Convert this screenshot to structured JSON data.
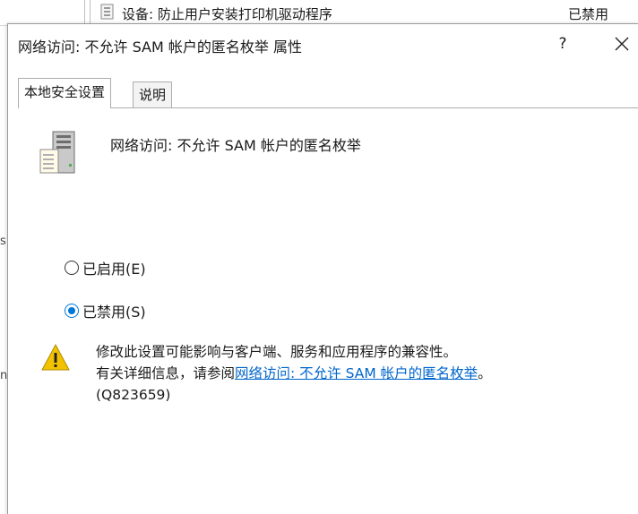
{
  "background_list": {
    "row_text": "设备: 防止用户安装打印机驱动程序",
    "row_status": "已禁用",
    "left_fragments": [
      "s",
      "n"
    ]
  },
  "dialog": {
    "title": "网络访问: 不允许 SAM 帐户的匿名枚举 属性",
    "help_label": "?",
    "tabs": [
      {
        "label": "本地安全设置",
        "active": true
      },
      {
        "label": "说明",
        "active": false
      }
    ],
    "policy_name": "网络访问: 不允许 SAM 帐户的匿名枚举",
    "options": [
      {
        "label": "已启用(E)",
        "checked": false
      },
      {
        "label": "已禁用(S)",
        "checked": true
      }
    ],
    "warning": {
      "line1": "修改此设置可能影响与客户端、服务和应用程序的兼容性。",
      "line2_prefix": "有关详细信息，请参阅",
      "link_text": "网络访问: 不允许 SAM 帐户的匿名枚举",
      "line2_suffix": "。",
      "line3": "(Q823659)"
    }
  },
  "colors": {
    "accent": "#0078d7",
    "link": "#0066cc",
    "warning_yellow": "#f2c200"
  },
  "icons": [
    "policy-icon",
    "warning-icon",
    "close-icon",
    "list-row-icon"
  ]
}
